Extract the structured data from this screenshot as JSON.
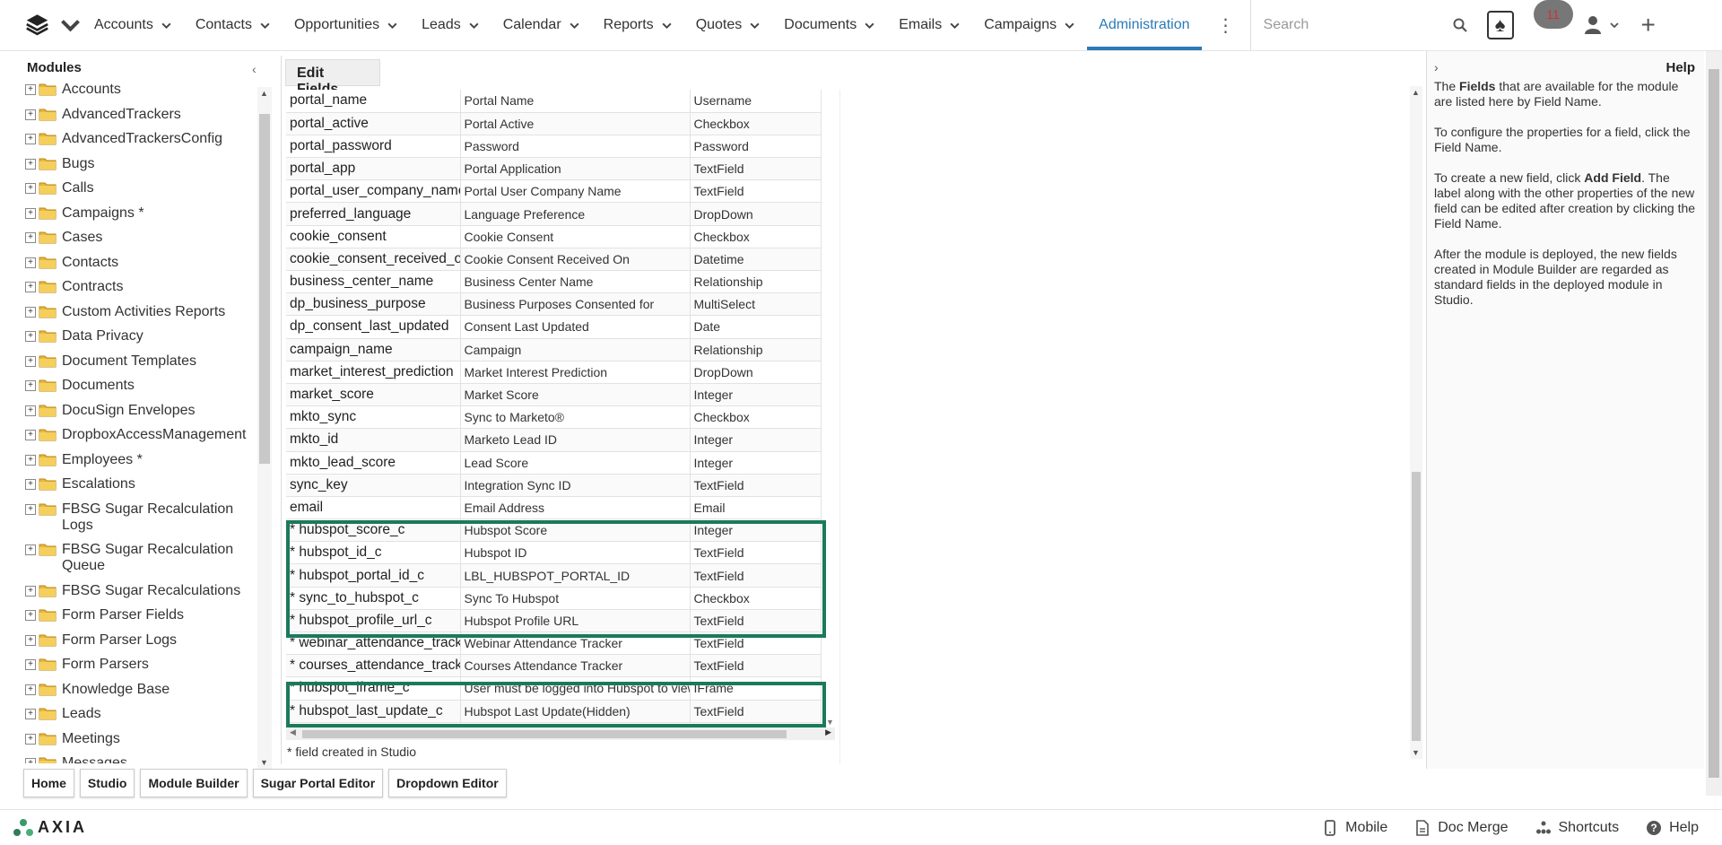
{
  "nav": {
    "items": [
      {
        "label": "Accounts",
        "active": false
      },
      {
        "label": "Contacts",
        "active": false
      },
      {
        "label": "Opportunities",
        "active": false
      },
      {
        "label": "Leads",
        "active": false
      },
      {
        "label": "Calendar",
        "active": false
      },
      {
        "label": "Reports",
        "active": false
      },
      {
        "label": "Quotes",
        "active": false
      },
      {
        "label": "Documents",
        "active": false
      },
      {
        "label": "Emails",
        "active": false
      },
      {
        "label": "Campaigns",
        "active": false
      },
      {
        "label": "Administration",
        "active": true
      }
    ],
    "search_placeholder": "Search",
    "notification_count": "11",
    "accent_color": "#2a7ab8"
  },
  "modules": {
    "title": "Modules",
    "items": [
      "Accounts",
      "AdvancedTrackers",
      "AdvancedTrackersConfig",
      "Bugs",
      "Calls",
      "Campaigns *",
      "Cases",
      "Contacts",
      "Contracts",
      "Custom Activities Reports",
      "Data Privacy",
      "Document Templates",
      "Documents",
      "DocuSign Envelopes",
      "DropboxAccessManagement",
      "Employees *",
      "Escalations",
      "FBSG Sugar Recalculation Logs",
      "FBSG Sugar Recalculation Queue",
      "FBSG Sugar Recalculations",
      "Form Parser Fields",
      "Form Parser Logs",
      "Form Parsers",
      "Knowledge Base",
      "Leads",
      "Meetings",
      "Messages"
    ]
  },
  "edit_fields": {
    "title": "Edit Fields",
    "rows": [
      [
        "portal_name",
        "Portal Name",
        "Username"
      ],
      [
        "portal_active",
        "Portal Active",
        "Checkbox"
      ],
      [
        "portal_password",
        "Password",
        "Password"
      ],
      [
        "portal_app",
        "Portal Application",
        "TextField"
      ],
      [
        "portal_user_company_name",
        "Portal User Company Name",
        "TextField"
      ],
      [
        "preferred_language",
        "Language Preference",
        "DropDown"
      ],
      [
        "cookie_consent",
        "Cookie Consent",
        "Checkbox"
      ],
      [
        "cookie_consent_received_on",
        "Cookie Consent Received On",
        "Datetime"
      ],
      [
        "business_center_name",
        "Business Center Name",
        "Relationship"
      ],
      [
        "dp_business_purpose",
        "Business Purposes Consented for",
        "MultiSelect"
      ],
      [
        "dp_consent_last_updated",
        "Consent Last Updated",
        "Date"
      ],
      [
        "campaign_name",
        "Campaign",
        "Relationship"
      ],
      [
        "market_interest_prediction",
        "Market Interest Prediction",
        "DropDown"
      ],
      [
        "market_score",
        "Market Score",
        "Integer"
      ],
      [
        "mkto_sync",
        "Sync to Marketo®",
        "Checkbox"
      ],
      [
        "mkto_id",
        "Marketo Lead ID",
        "Integer"
      ],
      [
        "mkto_lead_score",
        "Lead Score",
        "Integer"
      ],
      [
        "sync_key",
        "Integration Sync ID",
        "TextField"
      ],
      [
        "email",
        "Email Address",
        "Email"
      ],
      [
        "* hubspot_score_c",
        "Hubspot Score",
        "Integer"
      ],
      [
        "* hubspot_id_c",
        "Hubspot ID",
        "TextField"
      ],
      [
        "* hubspot_portal_id_c",
        "LBL_HUBSPOT_PORTAL_ID",
        "TextField"
      ],
      [
        "* sync_to_hubspot_c",
        "Sync To Hubspot",
        "Checkbox"
      ],
      [
        "* hubspot_profile_url_c",
        "Hubspot Profile URL",
        "TextField"
      ],
      [
        "* webinar_attendance_tracker_c",
        "Webinar Attendance Tracker",
        "TextField"
      ],
      [
        "* courses_attendance_tracker_c",
        "Courses Attendance Tracker",
        "TextField"
      ],
      [
        "* hubspot_iframe_c",
        "User must be logged into Hubspot to view",
        "IFrame"
      ],
      [
        "* hubspot_last_update_c",
        "Hubspot Last Update(Hidden)",
        "TextField"
      ]
    ],
    "footnote": "* field created in Studio",
    "highlight_color": "#1a7a5c"
  },
  "help": {
    "title": "Help",
    "p1_pre": "The ",
    "p1_bold": "Fields",
    "p1_post": " that are available for the module are listed here by Field Name.",
    "p2": "To configure the properties for a field, click the Field Name.",
    "p3_pre": "To create a new field, click ",
    "p3_bold": "Add Field",
    "p3_post": ". The label along with the other properties of the new field can be edited after creation by clicking the Field Name.",
    "p4": "After the module is deployed, the new fields created in Module Builder are regarded as standard fields in the deployed module in Studio."
  },
  "bottom_tabs": [
    "Home",
    "Studio",
    "Module Builder",
    "Sugar Portal Editor",
    "Dropdown Editor"
  ],
  "footer": {
    "brand": "AXIA",
    "mobile": "Mobile",
    "doc_merge": "Doc Merge",
    "shortcuts": "Shortcuts",
    "help": "Help"
  }
}
